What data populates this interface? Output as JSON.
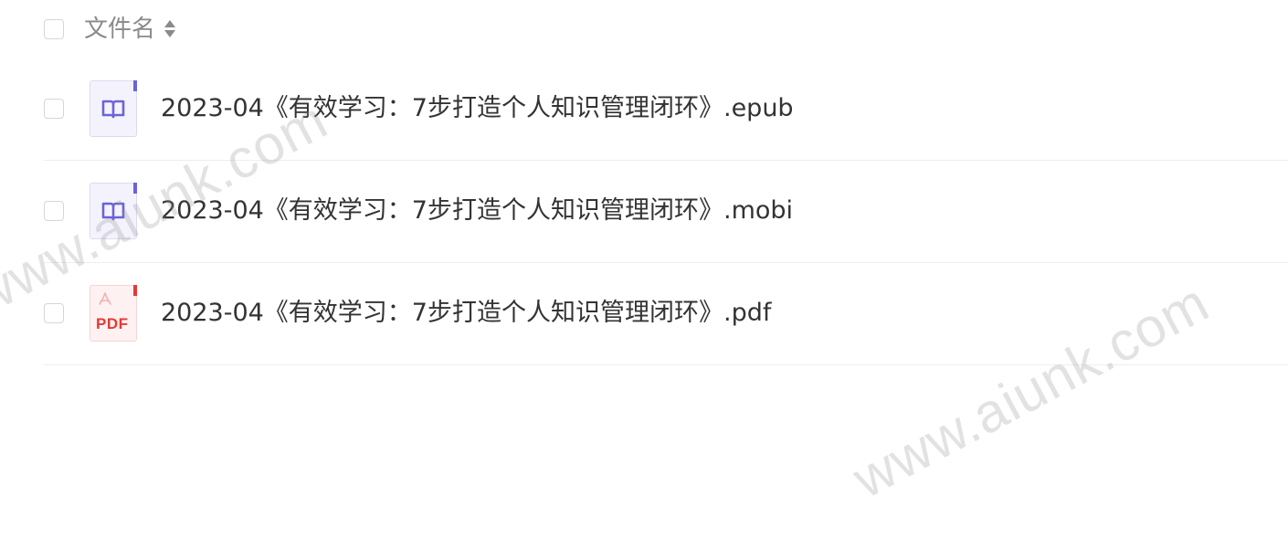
{
  "header": {
    "column_label": "文件名",
    "sort_icon": "sort-icon"
  },
  "files": [
    {
      "name": "2023-04《有效学习：7步打造个人知识管理闭环》.epub",
      "icon": "ebook-icon"
    },
    {
      "name": "2023-04《有效学习：7步打造个人知识管理闭环》.mobi",
      "icon": "ebook-icon"
    },
    {
      "name": "2023-04《有效学习：7步打造个人知识管理闭环》.pdf",
      "icon": "pdf-icon",
      "icon_text": "PDF"
    }
  ],
  "watermark": {
    "text": "www.aiunk.com"
  },
  "colors": {
    "ebook_accent": "#6b63d8",
    "pdf_accent": "#e53935"
  }
}
